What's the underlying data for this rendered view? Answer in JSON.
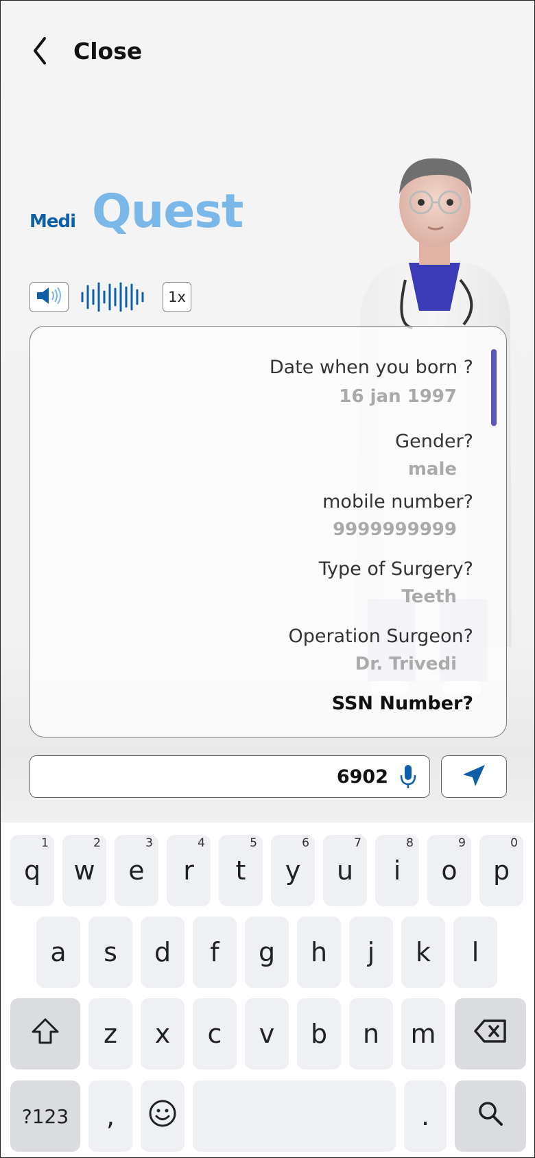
{
  "header": {
    "close_label": "Close"
  },
  "logo": {
    "part1": "Medi",
    "part2": "Quest"
  },
  "audio": {
    "speed_label": "1x"
  },
  "chat": {
    "items": [
      {
        "question": "Date when you born ?",
        "answer": "16 jan 1997"
      },
      {
        "question": "Gender?",
        "answer": "male"
      },
      {
        "question": "mobile number?",
        "answer": "9999999999"
      },
      {
        "question": "Type of Surgery?",
        "answer": "Teeth"
      },
      {
        "question": "Operation Surgeon?",
        "answer": "Dr. Trivedi"
      },
      {
        "question": "SSN Number?"
      }
    ]
  },
  "input": {
    "value": "6902"
  },
  "keyboard": {
    "row1": [
      {
        "k": "q",
        "n": "1"
      },
      {
        "k": "w",
        "n": "2"
      },
      {
        "k": "e",
        "n": "3"
      },
      {
        "k": "r",
        "n": "4"
      },
      {
        "k": "t",
        "n": "5"
      },
      {
        "k": "y",
        "n": "6"
      },
      {
        "k": "u",
        "n": "7"
      },
      {
        "k": "i",
        "n": "8"
      },
      {
        "k": "o",
        "n": "9"
      },
      {
        "k": "p",
        "n": "0"
      }
    ],
    "row2": [
      "a",
      "s",
      "d",
      "f",
      "g",
      "h",
      "j",
      "k",
      "l"
    ],
    "row3": [
      "z",
      "x",
      "c",
      "v",
      "b",
      "n",
      "m"
    ],
    "symbols_label": "?123",
    "comma": ",",
    "period": "."
  },
  "colors": {
    "brand_dark": "#0f5ea8",
    "brand_light": "#7ab8e9",
    "scroll": "#5a57b5"
  },
  "icons": [
    "chevron-left-icon",
    "speaker-icon",
    "waveform-icon",
    "mic-icon",
    "send-icon",
    "shift-icon",
    "backspace-icon",
    "emoji-icon",
    "search-icon"
  ]
}
